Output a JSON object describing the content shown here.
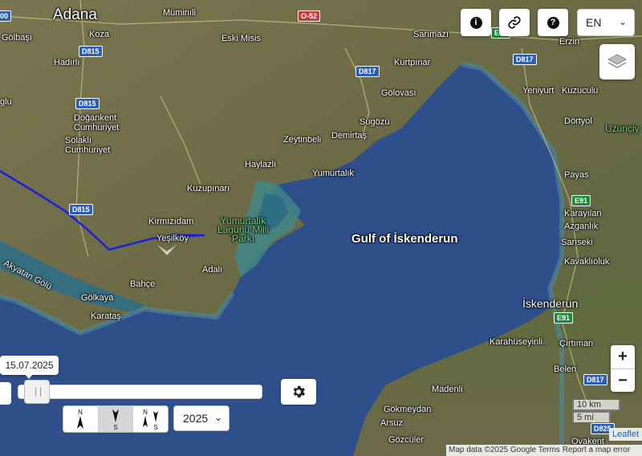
{
  "place_labels": {
    "adana": "Adana",
    "golbasi": "Gölbaşı",
    "koza": "Koza",
    "muminli": "Müminıli",
    "eski_misis": "Eski Misis",
    "sarimazi": "Sarımazı",
    "erzin": "Erzin",
    "hadirli": "Hadırlı",
    "kurtpinar": "Kurtpınar",
    "yeniyurt": "Yeniyurt",
    "kuzuculu": "Kuzuculu",
    "doganken_cumhuriyet": "Doğankent\nCumhuriyet",
    "golovasi": "Gölovası",
    "dortyol": "Dörtyol",
    "uzunciy": "Uzunçiy",
    "glu": "glu",
    "solakli_cumhuriyet": "Solaklı\nCumhuriyet",
    "sugozu": "Sugözü",
    "zeytinbeli": "Zeytinbeli",
    "demirtas": "Demirtaş",
    "haylazli": "Haylazlı",
    "yumurtalik": "Yumurtalık",
    "payas": "Payas",
    "kuzupinari": "Kuzupınarı",
    "yumurtalik_park": "Yumurtalık\nLagünü Milli\nParkı",
    "karayilan": "Karayılan",
    "azganlik": "Azganlık",
    "kirmizidam": "Kırmızıdam",
    "yesilkoy": "Yeşilköy",
    "sariseki": "Sarıseki",
    "gulf": "Gulf of İskenderun",
    "kavaklioluk": "Kavaklıoluk",
    "akyatan_golu": "Akyatan Gölü",
    "adali": "Adalı",
    "bahce": "Bahçe",
    "golkaya": "Gölkaya",
    "karatas": "Karataş",
    "iskenderun": "İskenderun",
    "karahuseyinli": "Karahüseyinli",
    "cirtiman": "Çırtıman",
    "belen": "Belen",
    "madenli": "Madenli",
    "gokmeydan": "Gökmeydan",
    "arsuz": "Arsuz",
    "gozculer": "Gözcüler",
    "ovakent": "Ovakent"
  },
  "road_shields": {
    "d815_a": "D815",
    "d815_b": "D815",
    "d815_c": "D815",
    "o52": "O-52",
    "d817_a": "D817",
    "d817_b": "D817",
    "e91_a": "E91",
    "e91_b": "E91",
    "e91_c": "E91",
    "d817_c": "D817",
    "d825": "D825",
    "edge_00": "00"
  },
  "top_controls": {
    "info_icon": "info-icon",
    "link_icon": "link-icon",
    "help_icon": "help-icon",
    "language": "EN"
  },
  "zoom": {
    "in": "+",
    "out": "−"
  },
  "scale": {
    "km": "10 km",
    "mi": "5 mi"
  },
  "leaflet": "Leaflet",
  "attribution": "Map data ©2025 Google   Terms   Report a map error",
  "timeline": {
    "date_tooltip": "15.07.2025",
    "slider_position": 0.03,
    "year": "2025"
  },
  "north_buttons": {
    "n_label": "N",
    "s_label": "S"
  },
  "colors": {
    "sea": "#2f4f8a",
    "route": "#1a22d8",
    "land": "#6b6a46"
  }
}
